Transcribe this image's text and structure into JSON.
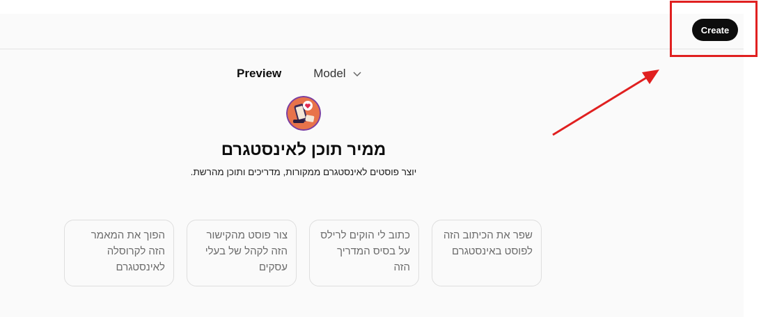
{
  "header": {
    "create_label": "Create"
  },
  "tabs": {
    "preview_label": "Preview",
    "model_label": "Model"
  },
  "gpt": {
    "name": "ממיר תוכן לאינסטגרם",
    "description": ".יוצר פוסטים לאינסטגרם ממקורות, מדריכים ותוכן מהרשת"
  },
  "starters": [
    {
      "text": "שפר את הכיתוב הזה לפוסט באינסטגרם"
    },
    {
      "text": "כתוב לי הוקים לרילס על בסיס המדריך הזה"
    },
    {
      "text": "צור פוסט מהקישור הזה לקהל של בעלי עסקים"
    },
    {
      "text": "הפוך את המאמר הזה לקרוסלה לאינסטגרם"
    }
  ],
  "colors": {
    "accent": "#0d0d0d",
    "annotation": "#e02020"
  },
  "icons": {
    "model_chevron": "chevron-down-icon",
    "avatar": "instagram-content-avatar"
  }
}
